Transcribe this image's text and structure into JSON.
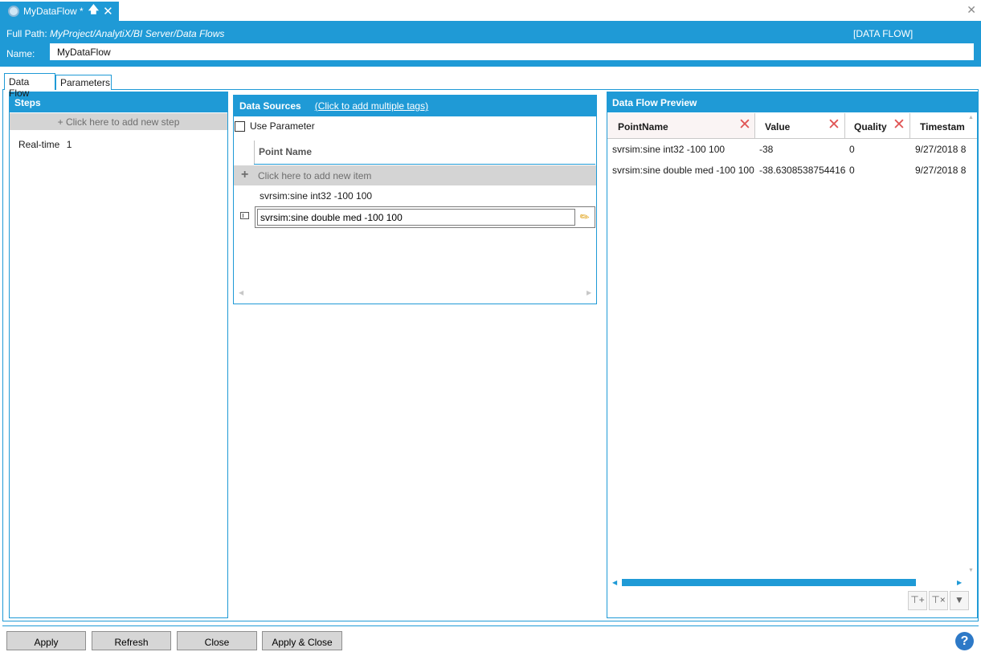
{
  "document_tab": {
    "title": "MyDataFlow *",
    "pin_icon": "pin-icon",
    "close_icon": "close-icon"
  },
  "window": {
    "close_glyph": "✕"
  },
  "header": {
    "full_path_label": "Full Path:",
    "full_path_value": "MyProject/AnalytiX/BI Server/Data Flows",
    "type_label": "[DATA FLOW]",
    "name_label": "Name:",
    "name_value": "MyDataFlow"
  },
  "tabs": [
    {
      "label": "Data Flow",
      "selected": true
    },
    {
      "label": "Parameters",
      "selected": false
    }
  ],
  "steps": {
    "title": "Steps",
    "add_label": "+ Click here to add new step",
    "items": [
      {
        "name": "Real-time",
        "count": "1"
      }
    ]
  },
  "data_sources": {
    "title": "Data Sources",
    "add_tags_link": "(Click to add multiple tags)",
    "use_parameter_label": "Use Parameter",
    "use_parameter_checked": false,
    "column_header": "Point Name",
    "add_item_label": "Click here to add new item",
    "rows": [
      "svrsim:sine int32 -100 100",
      "svrsim:sine double med -100 100"
    ]
  },
  "preview": {
    "title": "Data Flow Preview",
    "columns": [
      "PointName",
      "Value",
      "Quality",
      "Timestam"
    ],
    "rows": [
      {
        "point": "svrsim:sine int32 -100 100",
        "value": "-38",
        "quality": "0",
        "timestamp": "9/27/2018 8"
      },
      {
        "point": "svrsim:sine double med -100 100",
        "value": "-38.6308538754416",
        "quality": "0",
        "timestamp": "9/27/2018 8"
      }
    ],
    "toolbar_icons": [
      "add-column-icon",
      "remove-column-icon",
      "filter-icon"
    ]
  },
  "buttons": {
    "apply": "Apply",
    "refresh": "Refresh",
    "close": "Close",
    "apply_close": "Apply & Close",
    "help": "?"
  },
  "colors": {
    "accent": "#1f9ad6",
    "remove_mark": "#e05555",
    "help": "#2d79c7"
  }
}
